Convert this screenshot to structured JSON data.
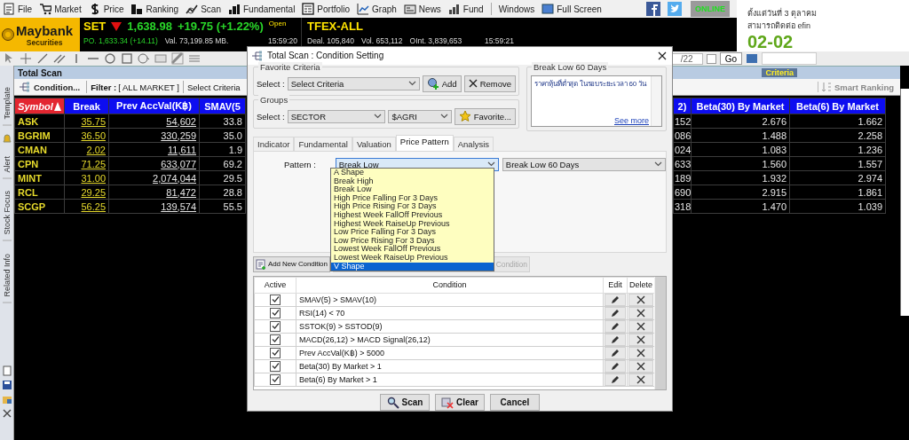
{
  "menu_bar": {
    "items": [
      {
        "label": "File"
      },
      {
        "label": "Market"
      },
      {
        "label": "Price"
      },
      {
        "label": "Ranking"
      },
      {
        "label": "Scan"
      },
      {
        "label": "Fundamental"
      },
      {
        "label": "Portfolio"
      },
      {
        "label": "Graph"
      },
      {
        "label": "News"
      },
      {
        "label": "Fund"
      },
      {
        "label": "Windows"
      },
      {
        "label": "Full Screen"
      }
    ],
    "status": "ONLINE"
  },
  "ad": {
    "lines": [
      "ตั้งแต่วันที่ 3 ตุลาคม",
      "สามารถติดต่อ efin",
      "02-02"
    ]
  },
  "ticker": {
    "broker": {
      "name": "Maybank",
      "sub": "Securities"
    },
    "set": {
      "label": "SET",
      "falling": true,
      "index": "1,638.98",
      "change": "+19.75 (+1.22%)",
      "session": "Open",
      "po": "PO. 1,633.34 (+14.11)",
      "value": "Val. 73,199.85 MB.",
      "time": "15:59:20"
    },
    "tfex": {
      "label": "TFEX-ALL",
      "deal": "Deal. 105,840",
      "volume": "Vol. 653,112",
      "oi": "OInt. 3,839,653",
      "time": "15:59:21"
    }
  },
  "drawing_toolbar": {
    "date_value": "/22",
    "checked": false,
    "go": "Go"
  },
  "panel": {
    "title": "Total Scan",
    "criteria": "Criteria",
    "toolbar": {
      "condition": "Condition...",
      "filter_label": "Filter :",
      "filter_value": "[ ALL MARKET ]",
      "select_criteria": "Select Criteria",
      "smart_ranking": "Smart Ranking"
    },
    "side_tabs": [
      "Template",
      "Alert",
      "Stock Focus",
      "Related Info"
    ],
    "table": {
      "columns": [
        {
          "label": "Symbol",
          "kind": "symbol",
          "sorted": true
        },
        {
          "label": "Break",
          "kind": "price",
          "sorted": false
        },
        {
          "label": "Prev AccVal(K฿)",
          "kind": "value",
          "sorted": false
        },
        {
          "label": "SMAV(5",
          "kind": "number",
          "sorted": false
        },
        {
          "label": "2)",
          "kind": "number",
          "sorted": false
        },
        {
          "label": "Beta(30) By Market",
          "kind": "number",
          "sorted": false
        },
        {
          "label": "Beta(6) By Market",
          "kind": "number",
          "sorted": false
        }
      ],
      "rows": [
        [
          "ASK",
          "35.75",
          "54,602",
          "33.8",
          "152",
          "2.676",
          "1.662"
        ],
        [
          "BGRIM",
          "36.50",
          "330,259",
          "35.0",
          "086",
          "1.488",
          "2.258"
        ],
        [
          "CMAN",
          "2.02",
          "11,611",
          "1.9",
          "024",
          "1.083",
          "1.236"
        ],
        [
          "CPN",
          "71.25",
          "633,077",
          "69.2",
          "633",
          "1.560",
          "1.557"
        ],
        [
          "MINT",
          "31.00",
          "2,074,044",
          "29.5",
          "189",
          "1.932",
          "2.974"
        ],
        [
          "RCL",
          "29.25",
          "81,472",
          "28.8",
          "690",
          "2.915",
          "1.861"
        ],
        [
          "SCGP",
          "56.25",
          "139,574",
          "55.5",
          "318",
          "1.470",
          "1.039"
        ]
      ]
    }
  },
  "dialog": {
    "title": "Total Scan : Condition Setting",
    "favorite": {
      "legend": "Favorite Criteria",
      "select_label": "Select :",
      "value": "Select Criteria",
      "add": "Add",
      "remove": "Remove"
    },
    "groups": {
      "legend": "Groups",
      "select_label": "Select :",
      "group": "SECTOR",
      "sector": "$AGRI",
      "favorite": "Favorite..."
    },
    "description": {
      "legend": "Break Low 60 Days",
      "text": "ราคาหุ้นที่ต่ำสุด ในรอบระยะเวลา 60 วัน",
      "link": "See more"
    },
    "tabs": [
      {
        "label": "Indicator",
        "selected": false
      },
      {
        "label": "Fundamental",
        "selected": false
      },
      {
        "label": "Valuation",
        "selected": false
      },
      {
        "label": "Price Pattern",
        "selected": true
      },
      {
        "label": "Analysis",
        "selected": false
      }
    ],
    "pattern": {
      "label": "Pattern :",
      "value": "Break Low",
      "detail": "Break Low 60 Days",
      "options": [
        {
          "label": "A Shape",
          "highlighted": false
        },
        {
          "label": "Break High",
          "highlighted": false
        },
        {
          "label": "Break Low",
          "highlighted": false
        },
        {
          "label": "High Price Falling For 3 Days",
          "highlighted": false
        },
        {
          "label": "High Price Rising For 3 Days",
          "highlighted": false
        },
        {
          "label": "Highest Week FallOff Previous",
          "highlighted": false
        },
        {
          "label": "Highest Week RaiseUp Previous",
          "highlighted": false
        },
        {
          "label": "Low Price Falling For 3 Days",
          "highlighted": false
        },
        {
          "label": "Low Price Rising For 3 Days",
          "highlighted": false
        },
        {
          "label": "Lowest Week FallOff Previous",
          "highlighted": false
        },
        {
          "label": "Lowest Week RaiseUp Previous",
          "highlighted": false
        },
        {
          "label": "V Shape",
          "highlighted": true
        }
      ]
    },
    "condition_buttons": [
      {
        "label": "Add New Condition",
        "disabled": false
      },
      {
        "label": "Condition",
        "disabled": true
      }
    ],
    "grid": {
      "columns": [
        "Active",
        "Condition",
        "Edit",
        "Delete"
      ],
      "rows": [
        {
          "active": true,
          "condition": "SMAV(5) > SMAV(10)"
        },
        {
          "active": true,
          "condition": "RSI(14) < 70"
        },
        {
          "active": true,
          "condition": "SSTOK(9) > SSTOD(9)"
        },
        {
          "active": true,
          "condition": "MACD(26,12) > MACD Signal(26,12)"
        },
        {
          "active": true,
          "condition": "Prev AccVal(K฿) > 5000"
        },
        {
          "active": true,
          "condition": "Beta(30) By Market > 1"
        },
        {
          "active": true,
          "condition": "Beta(6) By Market > 1"
        }
      ]
    },
    "actions": [
      "Scan",
      "Clear",
      "Cancel"
    ]
  }
}
